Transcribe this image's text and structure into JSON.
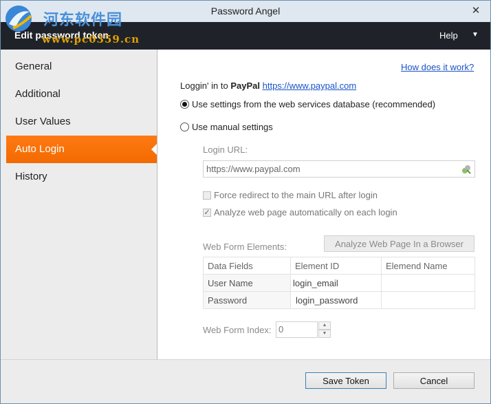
{
  "window": {
    "title": "Password Angel",
    "close_glyph": "✕"
  },
  "watermark": {
    "title": "河东软件园",
    "url": "www.pc0359.cn"
  },
  "header": {
    "title": "Edit password token",
    "help_label": "Help",
    "help_caret": "▼"
  },
  "sidebar": {
    "items": [
      {
        "label": "General"
      },
      {
        "label": "Additional"
      },
      {
        "label": "User Values"
      },
      {
        "label": "Auto Login"
      },
      {
        "label": "History"
      }
    ],
    "active_index": 3,
    "accent_color": "#f26a00"
  },
  "content": {
    "how_link": "How does it work?",
    "loggin_prefix": "Loggin' in to ",
    "site_name": "PayPal",
    "site_url": "https://www.paypal.com",
    "radio_db": "Use settings from the web services database (recommended)",
    "radio_db_checked": true,
    "radio_manual": "Use manual settings",
    "radio_manual_checked": false,
    "login_url_label": "Login URL:",
    "login_url_value": "https://www.paypal.com",
    "force_redirect_label": "Force redirect to the main URL after login",
    "force_redirect_checked": false,
    "analyze_auto_label": "Analyze web page automatically on each login",
    "analyze_auto_checked": true,
    "web_form_elements_label": "Web Form Elements:",
    "analyze_button": "Analyze Web Page In a Browser",
    "table": {
      "headers": [
        "Data Fields",
        "Element ID",
        "Elemend Name"
      ],
      "rows": [
        [
          "User Name",
          "login_email",
          ""
        ],
        [
          "Password",
          "login_password",
          ""
        ]
      ]
    },
    "web_form_index_label": "Web Form Index:",
    "web_form_index_value": "0"
  },
  "footer": {
    "save_label": "Save Token",
    "cancel_label": "Cancel"
  }
}
